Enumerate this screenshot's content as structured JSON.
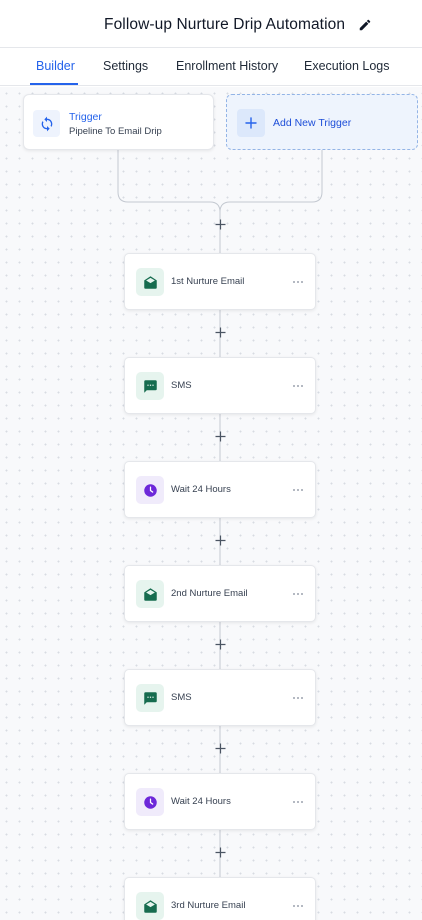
{
  "header": {
    "title": "Follow-up Nurture Drip Automation",
    "edit_icon": "pencil-icon"
  },
  "tabs": [
    {
      "label": "Builder",
      "active": true
    },
    {
      "label": "Settings",
      "active": false
    },
    {
      "label": "Enrollment History",
      "active": false
    },
    {
      "label": "Execution Logs",
      "active": false
    }
  ],
  "trigger": {
    "title": "Trigger",
    "subtitle": "Pipeline To Email Drip",
    "icon": "refresh-icon"
  },
  "add_trigger": {
    "label": "Add New Trigger",
    "icon": "plus-icon"
  },
  "colors": {
    "accent": "#2563eb",
    "email_icon": "#166c4f",
    "sms_icon": "#166c4f",
    "wait_icon": "#6d28d9"
  },
  "actions": [
    {
      "type": "email",
      "label": "1st Nurture Email",
      "icon": "email-icon"
    },
    {
      "type": "sms",
      "label": "SMS",
      "icon": "sms-icon"
    },
    {
      "type": "wait",
      "label": "Wait 24 Hours",
      "icon": "clock-icon"
    },
    {
      "type": "email",
      "label": "2nd Nurture Email",
      "icon": "email-icon"
    },
    {
      "type": "sms",
      "label": "SMS",
      "icon": "sms-icon"
    },
    {
      "type": "wait",
      "label": "Wait 24 Hours",
      "icon": "clock-icon"
    },
    {
      "type": "email",
      "label": "3rd Nurture Email",
      "icon": "email-icon"
    }
  ]
}
